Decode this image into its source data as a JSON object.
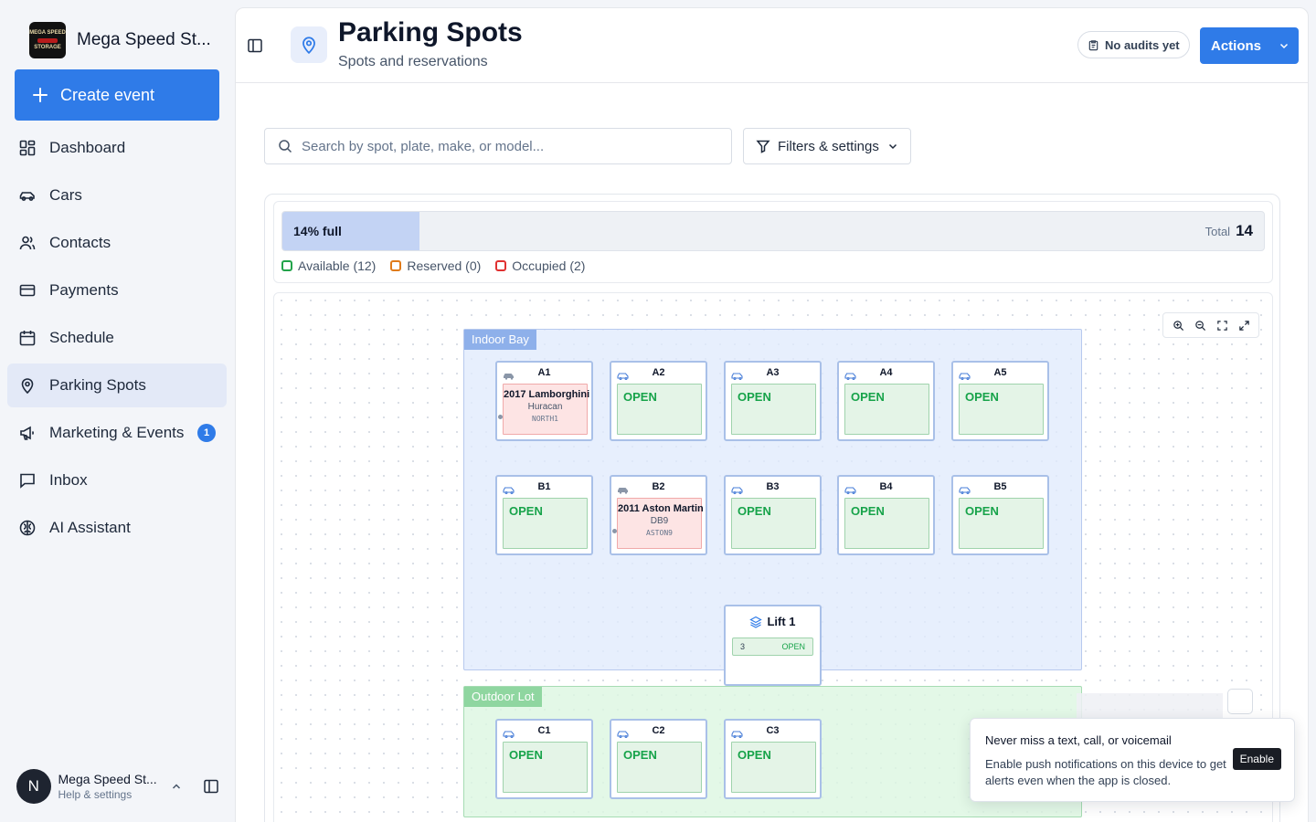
{
  "app": {
    "brand_name": "Mega Speed St...",
    "logo_text": [
      "MEGA SPEED",
      "STORAGE"
    ],
    "create_label": "Create event"
  },
  "nav": [
    {
      "label": "Dashboard",
      "icon": "dashboard-icon"
    },
    {
      "label": "Cars",
      "icon": "car-icon"
    },
    {
      "label": "Contacts",
      "icon": "users-icon"
    },
    {
      "label": "Payments",
      "icon": "credit-card-icon"
    },
    {
      "label": "Schedule",
      "icon": "calendar-icon"
    },
    {
      "label": "Parking Spots",
      "icon": "map-pin-icon",
      "active": true
    },
    {
      "label": "Marketing & Events",
      "icon": "megaphone-icon",
      "badge": "1"
    },
    {
      "label": "Inbox",
      "icon": "message-icon"
    },
    {
      "label": "AI Assistant",
      "icon": "brain-icon"
    }
  ],
  "user": {
    "initial": "N",
    "name": "Mega Speed St...",
    "sub": "Help & settings"
  },
  "header": {
    "title": "Parking Spots",
    "subtitle": "Spots and reservations",
    "audit_label": "No audits yet",
    "actions_label": "Actions"
  },
  "search": {
    "placeholder": "Search by spot, plate, make, or model..."
  },
  "filters_label": "Filters & settings",
  "occupancy": {
    "label": "14% full",
    "percent": 14,
    "total_label": "Total",
    "total": "14",
    "legend": [
      {
        "label": "Available (12)",
        "color": "#22a34a"
      },
      {
        "label": "Reserved (0)",
        "color": "#e07b1a"
      },
      {
        "label": "Occupied (2)",
        "color": "#e03131"
      }
    ]
  },
  "zones": {
    "indoor": "Indoor Bay",
    "outdoor": "Outdoor Lot"
  },
  "spots": {
    "A1": {
      "id": "A1",
      "car": "2017 Lamborghini",
      "model": "Huracan",
      "plate": "NORTH1"
    },
    "A2": {
      "id": "A2",
      "status": "OPEN"
    },
    "A3": {
      "id": "A3",
      "status": "OPEN"
    },
    "A4": {
      "id": "A4",
      "status": "OPEN"
    },
    "A5": {
      "id": "A5",
      "status": "OPEN"
    },
    "B1": {
      "id": "B1",
      "status": "OPEN"
    },
    "B2": {
      "id": "B2",
      "car": "2011 Aston Martin",
      "model": "DB9",
      "plate": "ASTON9"
    },
    "B3": {
      "id": "B3",
      "status": "OPEN"
    },
    "B4": {
      "id": "B4",
      "status": "OPEN"
    },
    "B5": {
      "id": "B5",
      "status": "OPEN"
    },
    "C1": {
      "id": "C1",
      "status": "OPEN"
    },
    "C2": {
      "id": "C2",
      "status": "OPEN"
    },
    "C3": {
      "id": "C3",
      "status": "OPEN"
    }
  },
  "lift": {
    "label": "Lift 1",
    "slot": "3",
    "status": "OPEN"
  },
  "notification": {
    "title": "Never miss a text, call, or voicemail",
    "body": "Enable push notifications on this device to get alerts even when the app is closed.",
    "button": "Enable"
  },
  "colors": {
    "accent": "#2f7be8",
    "open": "#17a34a",
    "occupied": "#f0a9a9"
  }
}
